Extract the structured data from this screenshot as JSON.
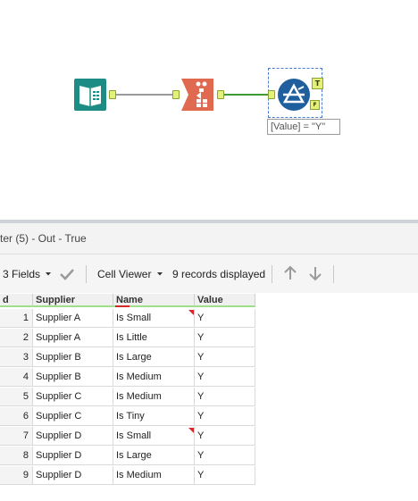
{
  "canvas": {
    "filter_expression": "[Value] = \"Y\"",
    "true_anchor_label": "T",
    "false_anchor_label": "F"
  },
  "results": {
    "title": "ter (5) - Out - True",
    "fields_label": "3 Fields",
    "cell_viewer_label": "Cell Viewer",
    "records_label": "9 records displayed",
    "columns": [
      {
        "label": "d"
      },
      {
        "label": "Supplier"
      },
      {
        "label": "Name"
      },
      {
        "label": "Value"
      }
    ],
    "rows": [
      {
        "num": "1",
        "supplier": "Supplier A",
        "name": "Is Small",
        "value": "Y",
        "flag": true
      },
      {
        "num": "2",
        "supplier": "Supplier A",
        "name": "Is Little",
        "value": "Y",
        "flag": false
      },
      {
        "num": "3",
        "supplier": "Supplier B",
        "name": "Is Large",
        "value": "Y",
        "flag": false
      },
      {
        "num": "4",
        "supplier": "Supplier B",
        "name": "Is Medium",
        "value": "Y",
        "flag": false
      },
      {
        "num": "5",
        "supplier": "Supplier C",
        "name": "Is Medium",
        "value": "Y",
        "flag": false
      },
      {
        "num": "6",
        "supplier": "Supplier C",
        "name": "Is Tiny",
        "value": "Y",
        "flag": false
      },
      {
        "num": "7",
        "supplier": "Supplier D",
        "name": "Is Small",
        "value": "Y",
        "flag": true
      },
      {
        "num": "8",
        "supplier": "Supplier D",
        "name": "Is Large",
        "value": "Y",
        "flag": false
      },
      {
        "num": "9",
        "supplier": "Supplier D",
        "name": "Is Medium",
        "value": "Y",
        "flag": false
      }
    ]
  },
  "colors": {
    "input_tool": "#1c8c84",
    "transpose_tool": "#e06a4f",
    "filter_tool": "#1f5f9e",
    "connection_grey": "#9a9a9a",
    "connection_green": "#3f9a3a",
    "header_underline": "#9ee08a",
    "error_flag": "#d62828"
  },
  "icons": {
    "input_tool": "book-icon",
    "transpose_tool": "transpose-icon",
    "filter_tool": "filter-triangle-icon",
    "dropdown": "caret-down-icon",
    "checkmark": "check-icon",
    "up": "arrow-up-icon",
    "down": "arrow-down-icon"
  }
}
